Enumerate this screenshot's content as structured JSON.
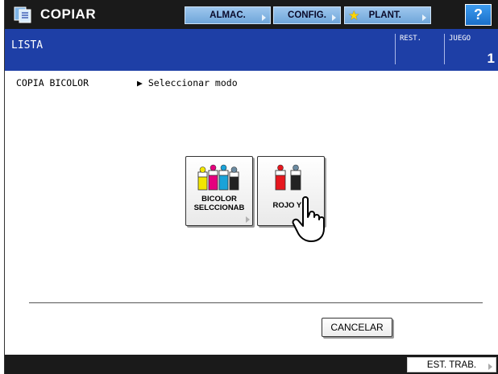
{
  "top_bar": {
    "app_title": "COPIAR",
    "app_icon": "copier-icon",
    "almac_label": "ALMAC.",
    "config_label": "CONFIG.",
    "plant_label": "PLANT.",
    "help_label": "?"
  },
  "header": {
    "list_title": "LISTA",
    "rest_label": "REST.",
    "juego_label": "JUEGO",
    "juego_value": "1"
  },
  "breadcrumb": {
    "mode": "COPIA BICOLOR",
    "step": "▶ Seleccionar modo"
  },
  "mode_buttons": {
    "bicolor_line1": "BICOLOR",
    "bicolor_line2": "SELCCIONAB",
    "rojo_label": "ROJO Y N"
  },
  "actions": {
    "cancel_label": "CANCELAR"
  },
  "bottom_bar": {
    "status_label": "EST. TRAB."
  },
  "colors": {
    "topbar_bg": "#1a1a1a",
    "header_bg": "#1e3fa6",
    "nav_button": "#8fbde9",
    "help_button": "#2a86e0"
  }
}
